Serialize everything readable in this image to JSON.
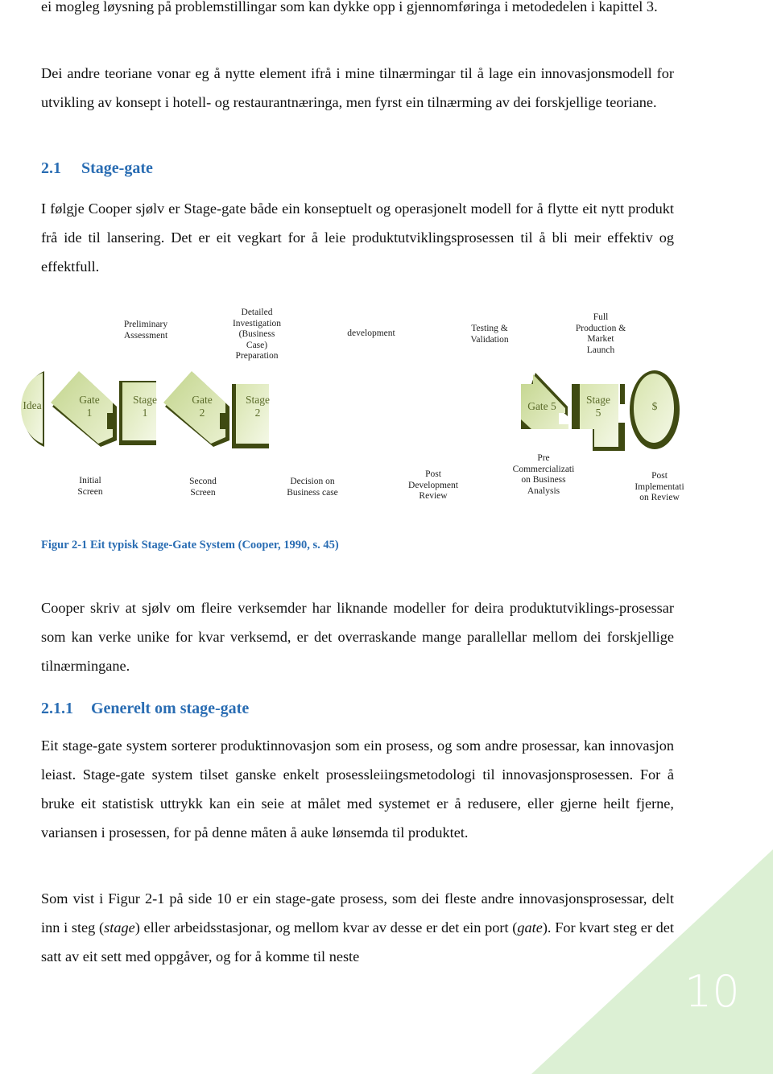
{
  "document": {
    "paragraphs": [
      "ei mogleg løysning på problemstillingar som kan dykke opp i gjennomføringa i metodedelen i kapittel 3.",
      "Dei andre teoriane vonar eg å nytte element ifrå i mine tilnærmingar til å lage ein innovasjonsmodell for utvikling av konsept i hotell- og restaurantnæringa, men fyrst ein tilnærming av dei forskjellige teoriane.",
      "I følgje Cooper sjølv er Stage-gate både ein konseptuelt og operasjonelt modell for å flytte eit nytt produkt frå ide til lansering. Det er eit vegkart for å leie produktutviklingsprosessen til å bli meir effektiv og effektfull.",
      "Cooper skriv at sjølv om fleire verksemder har liknande modeller for deira produktutviklings-prosessar som kan verke unike for kvar verksemd, er det overraskande mange parallellar mellom dei forskjellige tilnærmingane.",
      "Eit stage-gate system sorterer produktinnovasjon som ein prosess, og som andre prosessar, kan innovasjon leiast. Stage-gate system tilset ganske enkelt prosessleiingsmetodologi til innovasjonsprosessen. For å bruke eit statistisk uttrykk kan ein seie at målet med systemet er å redusere, eller gjerne heilt fjerne, variansen i prosessen, for på denne måten å auke lønsemda til produktet."
    ],
    "last_paragraph": {
      "part1": "Som vist i Figur 2-1 på side 10 er ein stage-gate prosess, som dei fleste andre innovasjonsprosessar, delt inn i steg (",
      "italic1": "stage",
      "part2": ") eller arbeidsstasjonar, og mellom kvar av desse er det ein port (",
      "italic2": "gate",
      "part3": "). For kvart steg er det satt av eit sett med oppgåver, og for å komme til neste"
    },
    "headings": {
      "h1_num": "2.1",
      "h1_text": "Stage-gate",
      "h2_num": "2.1.1",
      "h2_text": "Generelt om stage-gate"
    },
    "figure_caption": "Figur 2-1 Eit typisk Stage-Gate System (Cooper, 1990, s. 45)",
    "page_number": "10"
  },
  "diagram": {
    "top_labels": [
      "Preliminary\nAssessment",
      "Detailed\nInvestigation\n(Business\nCase)\nPreparation",
      "development",
      "Testing &\nValidation",
      "Full\nProduction &\nMarket\nLaunch"
    ],
    "shapes": {
      "idea": "Idea",
      "gate1": "Gate\n1",
      "stage1": "Stage\n1",
      "gate2": "Gate\n2",
      "stage2": "Stage\n2",
      "gate5": "Gate 5",
      "stage5": "Stage\n5",
      "end": "$"
    },
    "bottom_labels": [
      "Initial\nScreen",
      "Second\nScreen",
      "Decision on\nBusiness case",
      "Post\nDevelopment\nReview",
      "Pre\nCommercializati\non Business\nAnalysis",
      "Post\nImplementati\non Review"
    ],
    "colors": {
      "fill_light": "#eef3d8",
      "fill_mid": "#c9d996",
      "shadow": "#3f4a12",
      "text": "#5b6b2a"
    }
  },
  "theme": {
    "heading_color": "#2a6db3",
    "corner_color": "#dcf0d4"
  }
}
